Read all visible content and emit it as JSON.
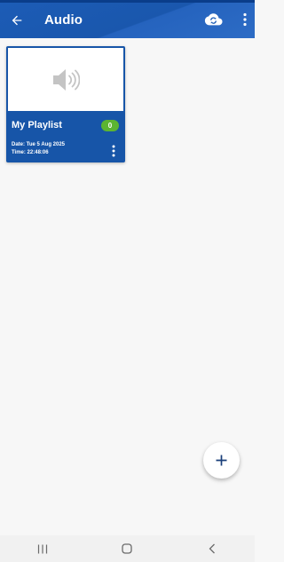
{
  "app_bar": {
    "title": "Audio",
    "back_icon": "arrow-back-icon",
    "cloud_icon": "cloud-sync-icon",
    "more_icon": "more-vertical-icon",
    "color": "#1c5cb6"
  },
  "playlists": [
    {
      "title": "My Playlist",
      "count": "0",
      "date": "Date: Tue 5 Aug 2025",
      "time": "Time:  22:48:06",
      "thumbnail_icon": "speaker-icon"
    }
  ],
  "fab": {
    "icon": "plus-icon"
  },
  "nav": {
    "recents_icon": "recents-icon",
    "home_icon": "home-icon",
    "back_icon": "back-chevron-icon"
  },
  "colors": {
    "card": "#1755a8",
    "badge": "#5cb531",
    "background": "#f7f7f7"
  }
}
